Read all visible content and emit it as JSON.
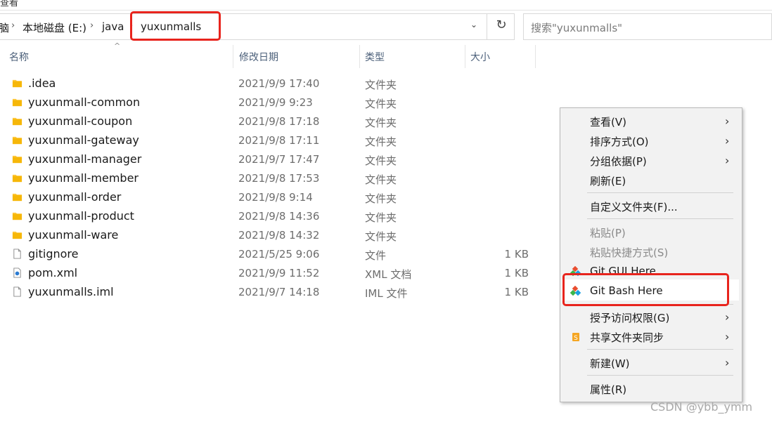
{
  "window": {
    "partial_title": "查看"
  },
  "address_bar": {
    "crumbs": [
      "脑",
      "本地磁盘 (E:)",
      "java",
      "yuxunmalls"
    ],
    "current_folder": "yuxunmalls"
  },
  "search": {
    "placeholder": "搜索\"yuxunmalls\""
  },
  "columns": {
    "name": "名称",
    "modified": "修改日期",
    "type": "类型",
    "size": "大小"
  },
  "files": [
    {
      "name": ".idea",
      "modified": "2021/9/9 17:40",
      "type": "文件夹",
      "size": "",
      "icon": "folder-icon"
    },
    {
      "name": "yuxunmall-common",
      "modified": "2021/9/9 9:23",
      "type": "文件夹",
      "size": "",
      "icon": "folder-icon"
    },
    {
      "name": "yuxunmall-coupon",
      "modified": "2021/9/8 17:18",
      "type": "文件夹",
      "size": "",
      "icon": "folder-icon"
    },
    {
      "name": "yuxunmall-gateway",
      "modified": "2021/9/8 17:11",
      "type": "文件夹",
      "size": "",
      "icon": "folder-icon"
    },
    {
      "name": "yuxunmall-manager",
      "modified": "2021/9/7 17:47",
      "type": "文件夹",
      "size": "",
      "icon": "folder-icon"
    },
    {
      "name": "yuxunmall-member",
      "modified": "2021/9/8 17:53",
      "type": "文件夹",
      "size": "",
      "icon": "folder-icon"
    },
    {
      "name": "yuxunmall-order",
      "modified": "2021/9/8 9:14",
      "type": "文件夹",
      "size": "",
      "icon": "folder-icon"
    },
    {
      "name": "yuxunmall-product",
      "modified": "2021/9/8 14:36",
      "type": "文件夹",
      "size": "",
      "icon": "folder-icon"
    },
    {
      "name": "yuxunmall-ware",
      "modified": "2021/9/8 14:32",
      "type": "文件夹",
      "size": "",
      "icon": "folder-icon"
    },
    {
      "name": "gitignore",
      "modified": "2021/5/25 9:06",
      "type": "文件",
      "size": "1 KB",
      "icon": "file-icon"
    },
    {
      "name": "pom.xml",
      "modified": "2021/9/9 11:52",
      "type": "XML 文档",
      "size": "1 KB",
      "icon": "xml-file-icon"
    },
    {
      "name": "yuxunmalls.iml",
      "modified": "2021/9/7 14:18",
      "type": "IML 文件",
      "size": "1 KB",
      "icon": "file-icon"
    }
  ],
  "context_menu": {
    "view": "查看(V)",
    "sort": "排序方式(O)",
    "group": "分组依据(P)",
    "refresh": "刷新(E)",
    "customize": "自定义文件夹(F)...",
    "paste": "粘贴(P)",
    "paste_shortcut": "粘贴快捷方式(S)",
    "git_gui": "Git GUI Here",
    "git_bash": "Git Bash Here",
    "grant_access": "授予访问权限(G)",
    "share_sync": "共享文件夹同步",
    "new": "新建(W)",
    "properties": "属性(R)"
  },
  "colors": {
    "highlight": "#e8241d",
    "folder": "#ffc83d",
    "header_text": "#4c607a"
  },
  "watermark": "CSDN @ybb_ymm"
}
